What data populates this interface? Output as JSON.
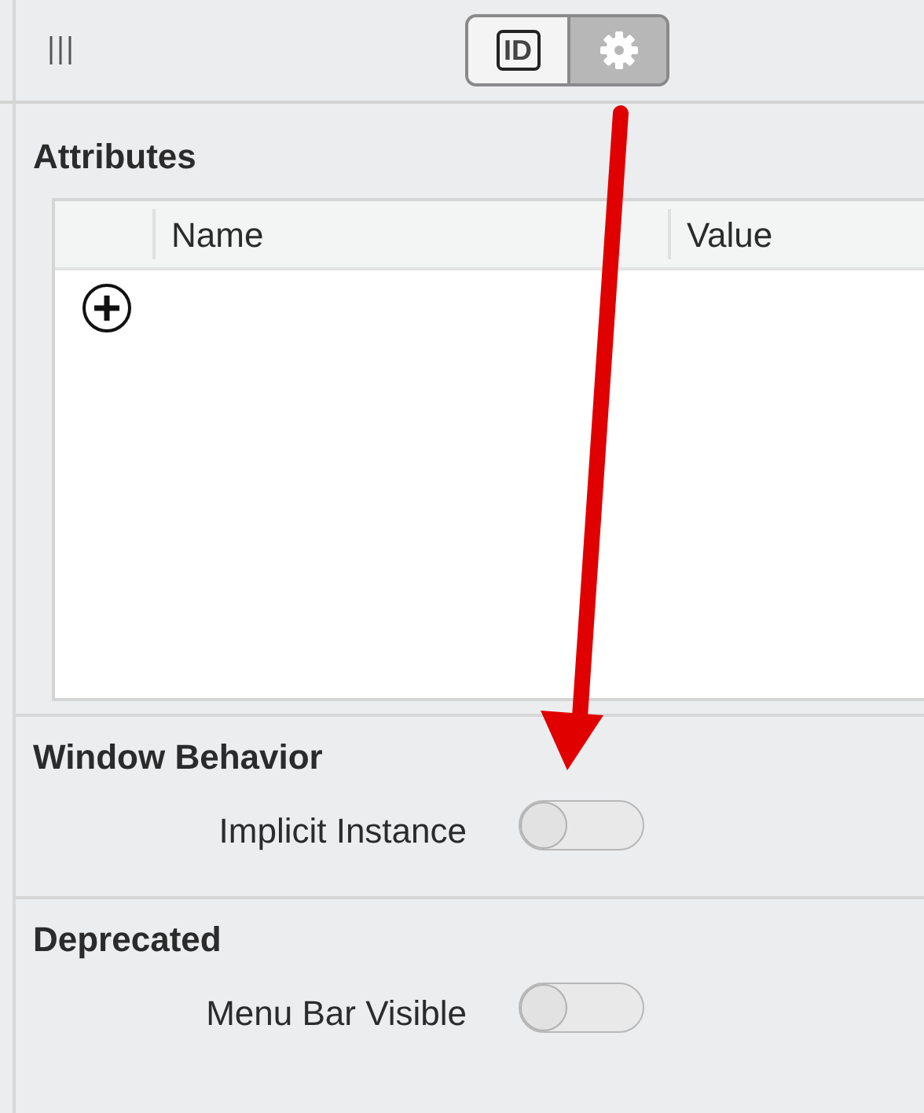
{
  "toolbar": {
    "tabs": [
      {
        "kind": "identity",
        "label": "ID",
        "selected": false
      },
      {
        "kind": "attributes",
        "selected": true
      }
    ]
  },
  "attributes": {
    "title": "Attributes",
    "table": {
      "columns": [
        "Name",
        "Value"
      ]
    }
  },
  "sections": [
    {
      "title": "Window Behavior",
      "rows": [
        {
          "label": "Implicit Instance",
          "on": false
        }
      ]
    },
    {
      "title": "Deprecated",
      "rows": [
        {
          "label": "Menu Bar Visible",
          "on": false
        }
      ]
    }
  ]
}
